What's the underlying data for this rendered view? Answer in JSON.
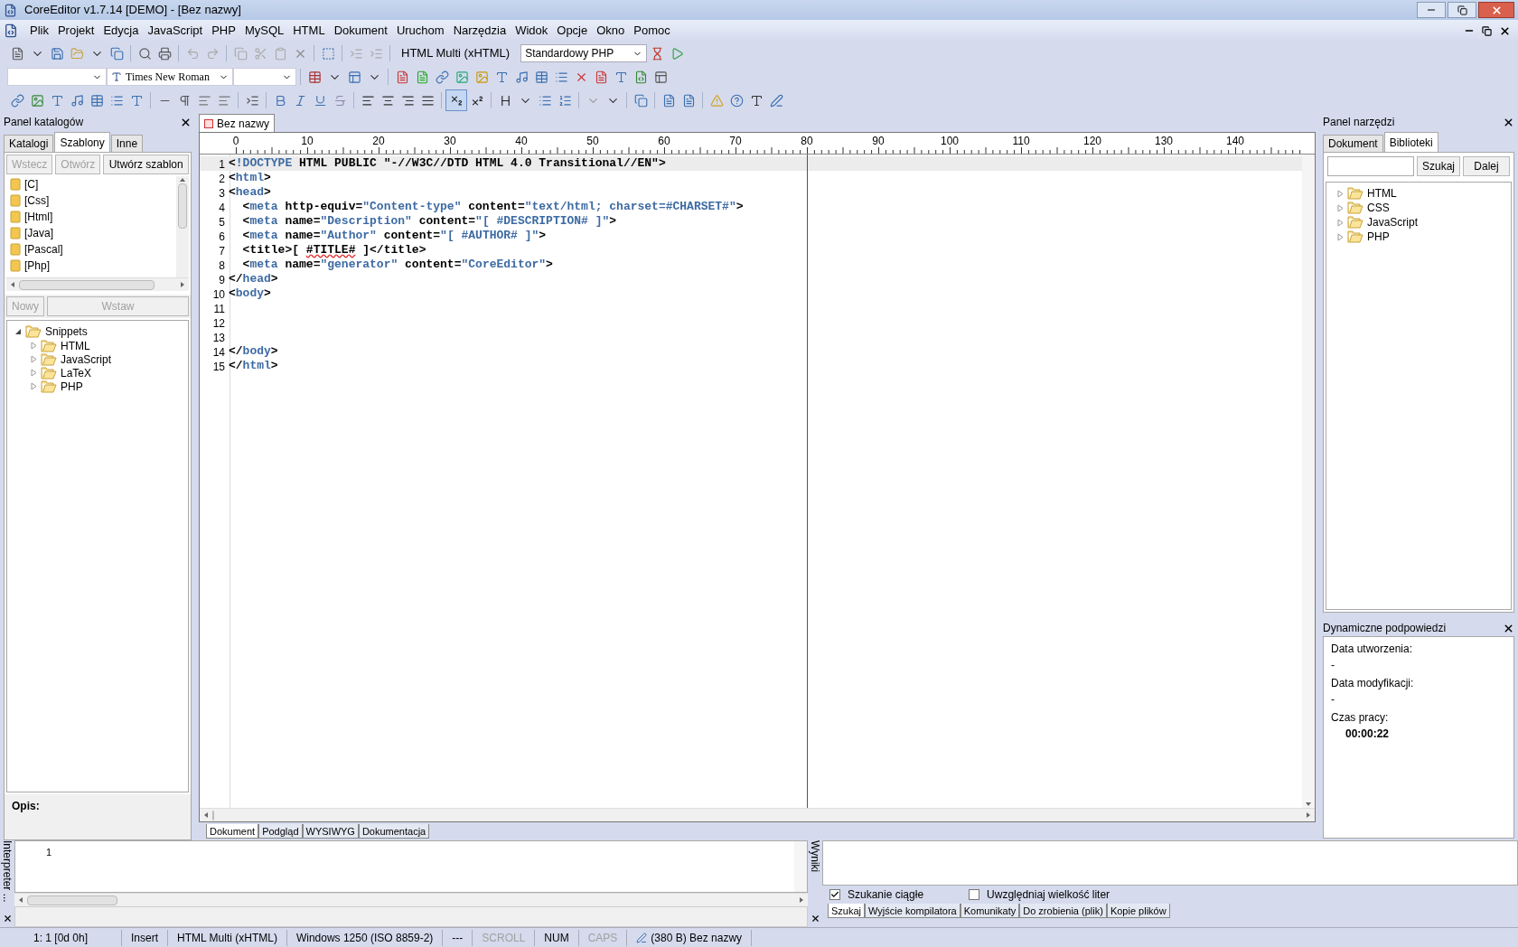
{
  "window": {
    "title": "CoreEditor v1.7.14 [DEMO] - [Bez nazwy]"
  },
  "menu": [
    "Plik",
    "Projekt",
    "Edycja",
    "JavaScript",
    "PHP",
    "MySQL",
    "HTML",
    "Dokument",
    "Uruchom",
    "Narzędzia",
    "Widok",
    "Opcje",
    "Okno",
    "Pomoc"
  ],
  "toolbar": {
    "mode_label": "HTML Multi (xHTML)",
    "template_select": "Standardowy PHP",
    "font_select": "Times New Roman"
  },
  "left_panel": {
    "title": "Panel katalogów",
    "tabs": [
      {
        "label": "Katalogi",
        "selected": false
      },
      {
        "label": "Szablony",
        "selected": true
      },
      {
        "label": "Inne",
        "selected": false
      }
    ],
    "buttons": [
      {
        "label": "Wstecz",
        "disabled": true
      },
      {
        "label": "Otwórz",
        "disabled": true
      },
      {
        "label": "Utwórz szablon",
        "disabled": false
      }
    ],
    "folders": [
      "[C]",
      "[Css]",
      "[Html]",
      "[Java]",
      "[Pascal]",
      "[Php]"
    ],
    "buttons_2": [
      {
        "label": "Nowy",
        "disabled": true
      },
      {
        "label": "Wstaw",
        "disabled": true
      }
    ],
    "tree": [
      {
        "label": "Snippets",
        "expanded": true,
        "children": [
          {
            "label": "HTML",
            "expanded": false
          },
          {
            "label": "JavaScript",
            "expanded": false
          },
          {
            "label": "LaTeX",
            "expanded": false
          },
          {
            "label": "PHP",
            "expanded": false
          }
        ]
      }
    ],
    "description_label": "Opis:"
  },
  "editor": {
    "tab": "Bez nazwy",
    "ruler": [
      "0",
      "10",
      "20",
      "30",
      "40",
      "50",
      "60",
      "70",
      "80",
      "90",
      "100",
      "110",
      "120",
      "130",
      "140"
    ],
    "lines": [
      {
        "number": "1",
        "current": true,
        "tokens": [
          {
            "kind": "plain",
            "text": "<"
          },
          {
            "kind": "tag",
            "text": "!DOCTYPE"
          },
          {
            "kind": "plain",
            "text": " HTML PUBLIC \"-//W3C//DTD HTML 4.0 Transitional//EN\">"
          }
        ]
      },
      {
        "number": "2",
        "current": false,
        "tokens": [
          {
            "kind": "plain",
            "text": "<"
          },
          {
            "kind": "tag",
            "text": "html"
          },
          {
            "kind": "plain",
            "text": ">"
          }
        ]
      },
      {
        "number": "3",
        "current": false,
        "tokens": [
          {
            "kind": "plain",
            "text": "<"
          },
          {
            "kind": "tag",
            "text": "head"
          },
          {
            "kind": "plain",
            "text": ">"
          }
        ]
      },
      {
        "number": "4",
        "current": false,
        "tokens": [
          {
            "kind": "plain",
            "text": "  <"
          },
          {
            "kind": "tag",
            "text": "meta"
          },
          {
            "kind": "plain",
            "text": " http-equiv="
          },
          {
            "kind": "value",
            "text": "\"Content-type\""
          },
          {
            "kind": "plain",
            "text": " content="
          },
          {
            "kind": "value",
            "text": "\"text/html; charset=#CHARSET#\""
          },
          {
            "kind": "plain",
            "text": ">"
          }
        ]
      },
      {
        "number": "5",
        "current": false,
        "tokens": [
          {
            "kind": "plain",
            "text": "  <"
          },
          {
            "kind": "tag",
            "text": "meta"
          },
          {
            "kind": "plain",
            "text": " name="
          },
          {
            "kind": "value",
            "text": "\"Description\""
          },
          {
            "kind": "plain",
            "text": " content="
          },
          {
            "kind": "value",
            "text": "\"[ #DESCRIPTION# ]\""
          },
          {
            "kind": "plain",
            "text": ">"
          }
        ]
      },
      {
        "number": "6",
        "current": false,
        "tokens": [
          {
            "kind": "plain",
            "text": "  <"
          },
          {
            "kind": "tag",
            "text": "meta"
          },
          {
            "kind": "plain",
            "text": " name="
          },
          {
            "kind": "value",
            "text": "\"Author\""
          },
          {
            "kind": "plain",
            "text": " content="
          },
          {
            "kind": "value",
            "text": "\"[ #AUTHOR# ]\""
          },
          {
            "kind": "plain",
            "text": ">"
          }
        ]
      },
      {
        "number": "7",
        "current": false,
        "tokens": [
          {
            "kind": "plain",
            "text": "  <title>[ "
          },
          {
            "kind": "misspelled",
            "text": "#TITLE#"
          },
          {
            "kind": "plain",
            "text": " ]</title>"
          }
        ]
      },
      {
        "number": "8",
        "current": false,
        "tokens": [
          {
            "kind": "plain",
            "text": "  <"
          },
          {
            "kind": "tag",
            "text": "meta"
          },
          {
            "kind": "plain",
            "text": " name="
          },
          {
            "kind": "value",
            "text": "\"generator\""
          },
          {
            "kind": "plain",
            "text": " content="
          },
          {
            "kind": "value",
            "text": "\"CoreEditor\""
          },
          {
            "kind": "plain",
            "text": ">"
          }
        ]
      },
      {
        "number": "9",
        "current": false,
        "tokens": [
          {
            "kind": "plain",
            "text": "</"
          },
          {
            "kind": "tag",
            "text": "head"
          },
          {
            "kind": "plain",
            "text": ">"
          }
        ]
      },
      {
        "number": "10",
        "current": false,
        "tokens": [
          {
            "kind": "plain",
            "text": "<"
          },
          {
            "kind": "tag",
            "text": "body"
          },
          {
            "kind": "plain",
            "text": ">"
          }
        ]
      },
      {
        "number": "11",
        "current": false
      },
      {
        "number": "12",
        "current": false
      },
      {
        "number": "13",
        "current": false
      },
      {
        "number": "14",
        "current": false,
        "tokens": [
          {
            "kind": "plain",
            "text": "</"
          },
          {
            "kind": "tag",
            "text": "body"
          },
          {
            "kind": "plain",
            "text": ">"
          }
        ]
      },
      {
        "number": "15",
        "current": false,
        "tokens": [
          {
            "kind": "plain",
            "text": "</"
          },
          {
            "kind": "tag",
            "text": "html"
          },
          {
            "kind": "plain",
            "text": ">"
          }
        ]
      }
    ],
    "view_tabs": [
      {
        "label": "Dokument",
        "selected": true
      },
      {
        "label": "Podgląd",
        "selected": false
      },
      {
        "label": "WYSIWYG",
        "selected": false
      },
      {
        "label": "Dokumentacja",
        "selected": false
      }
    ]
  },
  "right_panel": {
    "title": "Panel narzędzi",
    "tabs": [
      {
        "label": "Dokument",
        "selected": false
      },
      {
        "label": "Biblioteki",
        "selected": true
      }
    ],
    "search_button": "Szukaj",
    "next_button": "Dalej",
    "tree": [
      {
        "label": "HTML",
        "expanded": false
      },
      {
        "label": "CSS",
        "expanded": false
      },
      {
        "label": "JavaScript",
        "expanded": false
      },
      {
        "label": "PHP",
        "expanded": false
      }
    ]
  },
  "hints_panel": {
    "title": "Dynamiczne podpowiedzi",
    "fields": [
      {
        "label": "Data utworzenia:",
        "value": "-"
      },
      {
        "label": "Data modyfikacji:",
        "value": "-"
      },
      {
        "label": "Czas pracy:",
        "value": "00:00:22"
      }
    ]
  },
  "interpreter": {
    "title": "Interpreter ...",
    "line_number": "1"
  },
  "results": {
    "title": "Wyniki",
    "options": [
      {
        "label": "Szukanie ciągłe",
        "checked": true
      },
      {
        "label": "Uwzględniaj wielkość liter",
        "checked": false
      }
    ],
    "tabs": [
      {
        "label": "Szukaj",
        "selected": true
      },
      {
        "label": "Wyjście kompilatora",
        "selected": false
      },
      {
        "label": "Komunikaty",
        "selected": false
      },
      {
        "label": "Do zrobienia (plik)",
        "selected": false
      },
      {
        "label": "Kopie plików",
        "selected": false
      }
    ]
  },
  "status_bar": [
    {
      "text": "1: 1 [0d 0h]",
      "enabled": true
    },
    {
      "text": "Insert",
      "enabled": true
    },
    {
      "text": "HTML Multi (xHTML)",
      "enabled": true
    },
    {
      "text": "Windows 1250 (ISO 8859-2)",
      "enabled": true
    },
    {
      "text": "---",
      "enabled": true
    },
    {
      "text": "SCROLL",
      "enabled": false
    },
    {
      "text": "NUM",
      "enabled": true
    },
    {
      "text": "CAPS",
      "enabled": false
    },
    {
      "text": "(380 B) Bez nazwy",
      "enabled": true
    }
  ]
}
